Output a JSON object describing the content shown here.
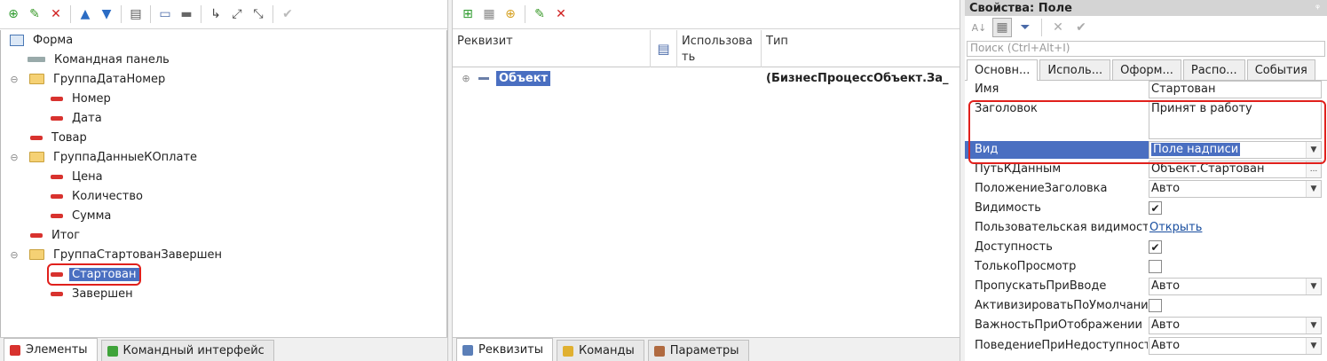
{
  "left": {
    "tree": [
      {
        "label": "Форма",
        "level": 0,
        "icon": "form-icon"
      },
      {
        "label": "Командная панель",
        "level": 1,
        "icon": "command-panel-icon"
      },
      {
        "label": "ГруппаДатаНомер",
        "level": 1,
        "icon": "folder-icon",
        "toggle": "⊖"
      },
      {
        "label": "Номер",
        "level": 2,
        "icon": "attribute-icon"
      },
      {
        "label": "Дата",
        "level": 2,
        "icon": "attribute-icon"
      },
      {
        "label": "Товар",
        "level": 1,
        "icon": "attribute-icon"
      },
      {
        "label": "ГруппаДанныеКОплате",
        "level": 1,
        "icon": "folder-icon",
        "toggle": "⊖"
      },
      {
        "label": "Цена",
        "level": 2,
        "icon": "attribute-icon"
      },
      {
        "label": "Количество",
        "level": 2,
        "icon": "attribute-icon"
      },
      {
        "label": "Сумма",
        "level": 2,
        "icon": "attribute-icon"
      },
      {
        "label": "Итог",
        "level": 1,
        "icon": "attribute-icon"
      },
      {
        "label": "ГруппаСтартованЗавершен",
        "level": 1,
        "icon": "folder-icon",
        "toggle": "⊖"
      },
      {
        "label": "Стартован",
        "level": 2,
        "icon": "attribute-icon",
        "selected": true
      },
      {
        "label": "Завершен",
        "level": 2,
        "icon": "attribute-icon"
      }
    ],
    "tabs": [
      {
        "label": "Элементы",
        "active": true,
        "color": "#d8322e"
      },
      {
        "label": "Командный интерфейс",
        "active": false,
        "color": "#3fa33a"
      }
    ]
  },
  "middle": {
    "columns": {
      "requisite": "Реквизит",
      "usage": "Использова\nть",
      "type": "Тип"
    },
    "row": {
      "toggle": "⊕",
      "name": "Объект",
      "type": "(БизнесПроцессОбъект.За_"
    },
    "tabs": [
      {
        "label": "Реквизиты",
        "active": true,
        "color": "#5b7fb8"
      },
      {
        "label": "Команды",
        "active": false,
        "color": "#e0b030"
      },
      {
        "label": "Параметры",
        "active": false,
        "color": "#b06a40"
      }
    ]
  },
  "props": {
    "title": "Свойства: Поле",
    "pin": "ᵠ",
    "search_placeholder": "Поиск (Ctrl+Alt+I)",
    "tabs": [
      "Основн...",
      "Исполь...",
      "Оформ...",
      "Распо...",
      "События"
    ],
    "rows": {
      "name": {
        "label": "Имя",
        "value": "Стартован"
      },
      "title": {
        "label": "Заголовок",
        "value": "Принят в работу"
      },
      "kind": {
        "label": "Вид",
        "value": "Поле надписи"
      },
      "path": {
        "label": "ПутьКДанным",
        "value": "Объект.Стартован",
        "btn": "..."
      },
      "title_pos": {
        "label": "ПоложениеЗаголовка",
        "value": "Авто"
      },
      "visible": {
        "label": "Видимость",
        "checked": true
      },
      "user_vis": {
        "label": "Пользовательская видимость",
        "value": "Открыть"
      },
      "enabled": {
        "label": "Доступность",
        "checked": true
      },
      "readonly": {
        "label": "ТолькоПросмотр",
        "checked": false
      },
      "skip": {
        "label": "ПропускатьПриВводе",
        "value": "Авто"
      },
      "activate": {
        "label": "АктивизироватьПоУмолчанию",
        "checked": false
      },
      "importance": {
        "label": "ВажностьПриОтображении",
        "value": "Авто"
      },
      "behavior": {
        "label": "ПоведениеПриНедоступности",
        "value": "Авто"
      }
    }
  },
  "colors": {
    "selection": "#4a6fc1",
    "highlight": "#e0201c"
  }
}
